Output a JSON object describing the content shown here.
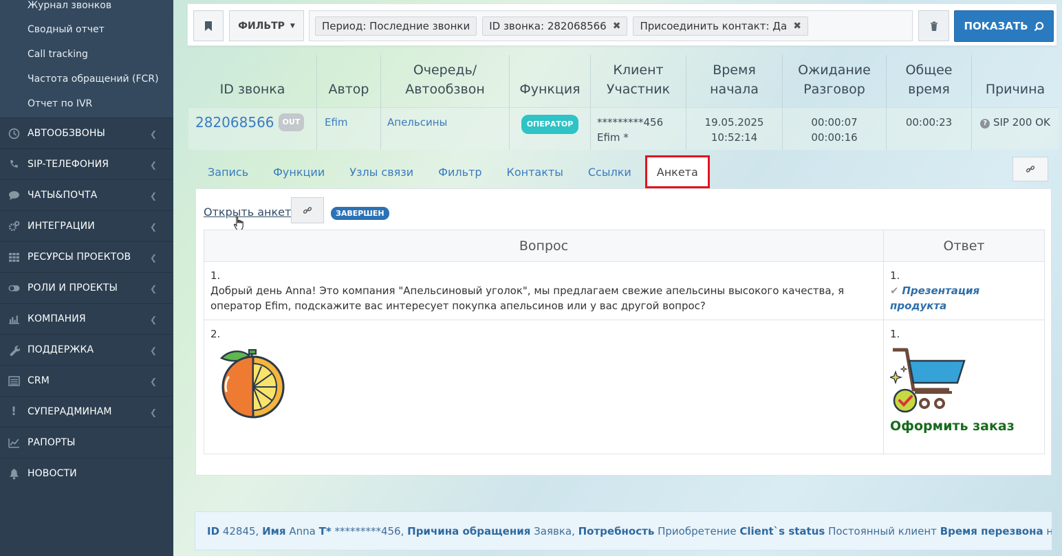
{
  "sidebar": {
    "sub_items": [
      {
        "label": "Журнал звонков"
      },
      {
        "label": "Сводный отчет"
      },
      {
        "label": "Call tracking"
      },
      {
        "label": "Частота обращений (FCR)"
      },
      {
        "label": "Отчет по IVR"
      }
    ],
    "menu": [
      {
        "label": "АВТООБЗВОНЫ",
        "icon": "clock-icon",
        "chevron": true
      },
      {
        "label": "SIP-ТЕЛЕФОНИЯ",
        "icon": "phone-icon",
        "chevron": true
      },
      {
        "label": "ЧАТЫ&ПОЧТА",
        "icon": "chat-icon",
        "chevron": true
      },
      {
        "label": "ИНТЕГРАЦИИ",
        "icon": "gears-icon",
        "chevron": true
      },
      {
        "label": "РЕСУРСЫ ПРОЕКТОВ",
        "icon": "grid-icon",
        "chevron": true
      },
      {
        "label": "РОЛИ И ПРОЕКТЫ",
        "icon": "toggle-icon",
        "chevron": true
      },
      {
        "label": "КОМПАНИЯ",
        "icon": "bar-chart-icon",
        "chevron": true
      },
      {
        "label": "ПОДДЕРЖКА",
        "icon": "wrench-icon",
        "chevron": true
      },
      {
        "label": "CRM",
        "icon": "list-icon",
        "chevron": true
      },
      {
        "label": "СУПЕРАДМИНАМ",
        "icon": "exclamation-icon",
        "chevron": true
      },
      {
        "label": "РАПОРТЫ",
        "icon": "line-chart-icon",
        "chevron": false
      },
      {
        "label": "НОВОСТИ",
        "icon": "bell-icon",
        "chevron": false
      }
    ]
  },
  "filterbar": {
    "filter_label": "ФИЛЬТР",
    "tags": [
      {
        "label": "Период: Последние звонки",
        "removable": false
      },
      {
        "label": "ID звонка: 282068566",
        "removable": true
      },
      {
        "label": "Присоединить контакт: Да",
        "removable": true
      }
    ],
    "show_label": "ПОКАЗАТЬ"
  },
  "call_table": {
    "headers": {
      "id": "ID звонка",
      "author": "Автор",
      "queue_1": "Очередь/",
      "queue_2": "Автообзвон",
      "function": "Функция",
      "client_1": "Клиент",
      "client_2": "Участник",
      "start_1": "Время",
      "start_2": "начала",
      "wait_1": "Ожидание",
      "wait_2": "Разговор",
      "total_1": "Общее",
      "total_2": "время",
      "reason": "Причина"
    },
    "row": {
      "id": "282068566",
      "direction": "OUT",
      "author": "Efim",
      "queue": "Апельсины",
      "function": "ОПЕРАТОР",
      "client": "*********456",
      "participant": "Efim *",
      "start_date": "19.05.2025",
      "start_time": "10:52:14",
      "wait": "00:00:07",
      "talk": "00:00:16",
      "total": "00:00:23",
      "reason": "SIP 200 OK"
    }
  },
  "tabs": [
    {
      "label": "Запись"
    },
    {
      "label": "Функции"
    },
    {
      "label": "Узлы связи"
    },
    {
      "label": "Фильтр"
    },
    {
      "label": "Контакты"
    },
    {
      "label": "Ссылки"
    },
    {
      "label": "Анкета",
      "active": true
    }
  ],
  "form": {
    "open_label": "Открыть анкету",
    "status": "ЗАВЕРШЕН",
    "headers": {
      "question": "Вопрос",
      "answer": "Ответ"
    },
    "rows": [
      {
        "q_num": "1.",
        "q_text": "Добрый день Anna! Это компания \"Апельсиновый уголок\", мы предлагаем свежие апельсины высокого качества, я оператор Efim, подскажите вас интересует покупка апельсинов или у вас другой вопрос?",
        "a_num": "1.",
        "a_text": "Презентация продукта"
      },
      {
        "q_num": "2.",
        "q_image": "orange-image",
        "a_num": "1.",
        "a_image": "shopping-cart-image",
        "a_text": "Оформить заказ"
      }
    ]
  },
  "infobar": {
    "id_label": "ID",
    "id_value": "42845,",
    "name_label": "Имя",
    "name_value": "Anna",
    "t_label": "T*",
    "t_value": "*********456,",
    "reason_label": "Причина обращения",
    "reason_value": "Заявка,",
    "need_label": "Потребность",
    "need_value": "Приобретение",
    "status_label": "Client`s status",
    "status_value": "Постоянный клиент",
    "callback_label": "Время перезвона",
    "callback_value": "нет,"
  },
  "colors": {
    "sidebar_bg": "#2c3e50",
    "accent_blue": "#2a7ac0",
    "link_blue": "#3a7bbf",
    "operator_badge": "#2ec3c6",
    "active_tab_border": "#e3121f",
    "order_green": "#156b1b"
  }
}
